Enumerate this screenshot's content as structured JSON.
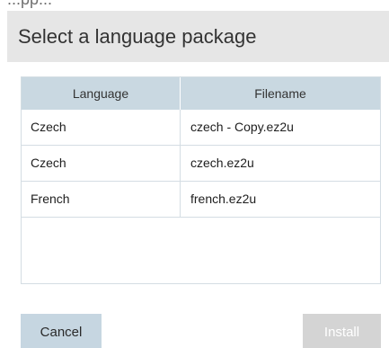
{
  "top_partial_text": "...pp...",
  "dialog": {
    "title": "Select a language package"
  },
  "table": {
    "columns": [
      "Language",
      "Filename"
    ],
    "rows": [
      {
        "language": "Czech",
        "filename": "czech - Copy.ez2u"
      },
      {
        "language": "Czech",
        "filename": "czech.ez2u"
      },
      {
        "language": "French",
        "filename": "french.ez2u"
      }
    ]
  },
  "buttons": {
    "cancel": "Cancel",
    "install": "Install"
  },
  "colors": {
    "header_bg": "#e6e6e6",
    "table_header_bg": "#c9d8e1",
    "cancel_bg": "#c6d6e1",
    "install_disabled_bg": "#d4d4d4"
  }
}
